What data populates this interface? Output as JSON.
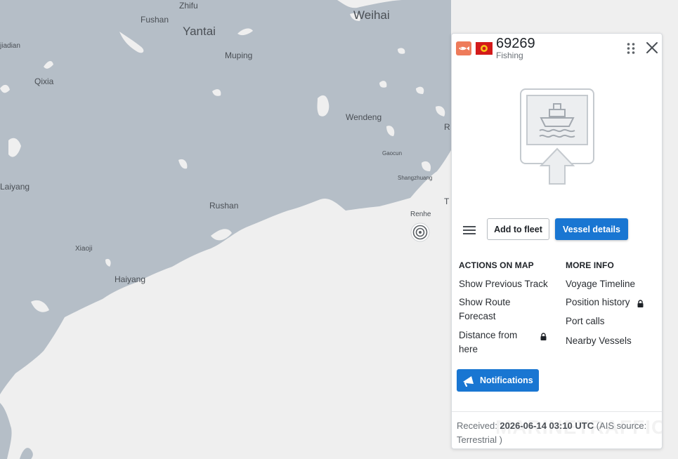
{
  "map": {
    "places": {
      "zhifu": "Zhifu",
      "fushan": "Fushan",
      "yantai": "Yantai",
      "weihai": "Weihai",
      "jiadian": "jiadian",
      "muping": "Muping",
      "qixia": "Qixia",
      "wendeng": "Wendeng",
      "r_partial": "R",
      "gaocun": "Gaocun",
      "shangzhuang": "Shangzhuang",
      "laiyang": "Laiyang",
      "rushan": "Rushan",
      "renhe": "Renhe",
      "t_partial": "T",
      "xiaoji": "Xiaoji",
      "haiyang": "Haiyang"
    },
    "colors": {
      "land": "#b5bec7",
      "sea": "#efefef",
      "label": "#4a4f55"
    }
  },
  "panel": {
    "vessel_name": "69269",
    "vessel_type": "Fishing",
    "type_icon": "fishing-vessel-icon",
    "flag_icon": "flag-icon",
    "buttons": {
      "add_to_fleet": "Add to fleet",
      "vessel_details": "Vessel details",
      "notifications": "Notifications"
    },
    "actions_on_map": {
      "title": "ACTIONS ON MAP",
      "items": [
        "Show Previous Track",
        "Show Route Forecast",
        "Distance from here"
      ]
    },
    "more_info": {
      "title": "MORE INFO",
      "items": [
        "Voyage Timeline",
        "Position history",
        "Port calls",
        "Nearby Vessels"
      ]
    },
    "footer": {
      "received_label": "Received: ",
      "received_time": "2026-06-14 03:10 UTC",
      "source_text": " (AIS source: Terrestrial )",
      "watermark": "MARINETRAFFIC"
    },
    "colors": {
      "primary": "#1976d2",
      "type_badge": "#ee7b5a",
      "flag": "#d31a1a"
    }
  }
}
